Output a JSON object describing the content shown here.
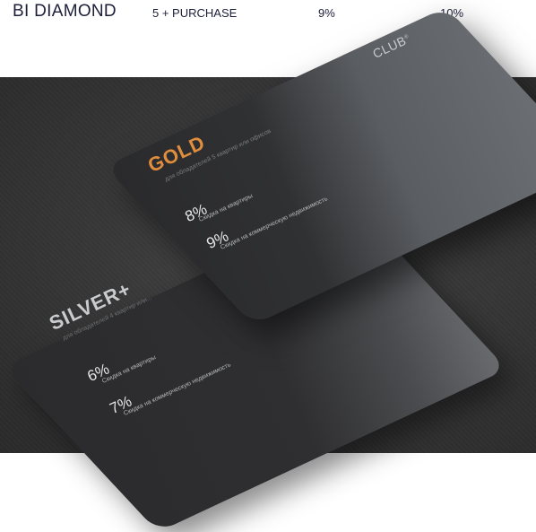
{
  "tier_row": {
    "name": "BI DIAMOND",
    "condition": "5 + PURCHASE",
    "discount_apartments": "9%",
    "discount_commercial": "10%"
  },
  "gold_card": {
    "brand": "CLUB",
    "title": "GOLD",
    "subtitle": "для обладателей 5 квартир или офисов",
    "discount_1": "8%",
    "discount_1_label": "Скидка на квартиры",
    "discount_2": "9%",
    "discount_2_label": "Скидка на коммерческую недвижимость",
    "title_color": "#e08e3e"
  },
  "silver_card": {
    "title": "SILVER+",
    "subtitle": "для обладателей 4 квартир или...",
    "discount_1": "6%",
    "discount_1_label": "Скидка на квартиры",
    "discount_2": "7%",
    "discount_2_label": "Скидка на коммерческую недвижимость"
  }
}
